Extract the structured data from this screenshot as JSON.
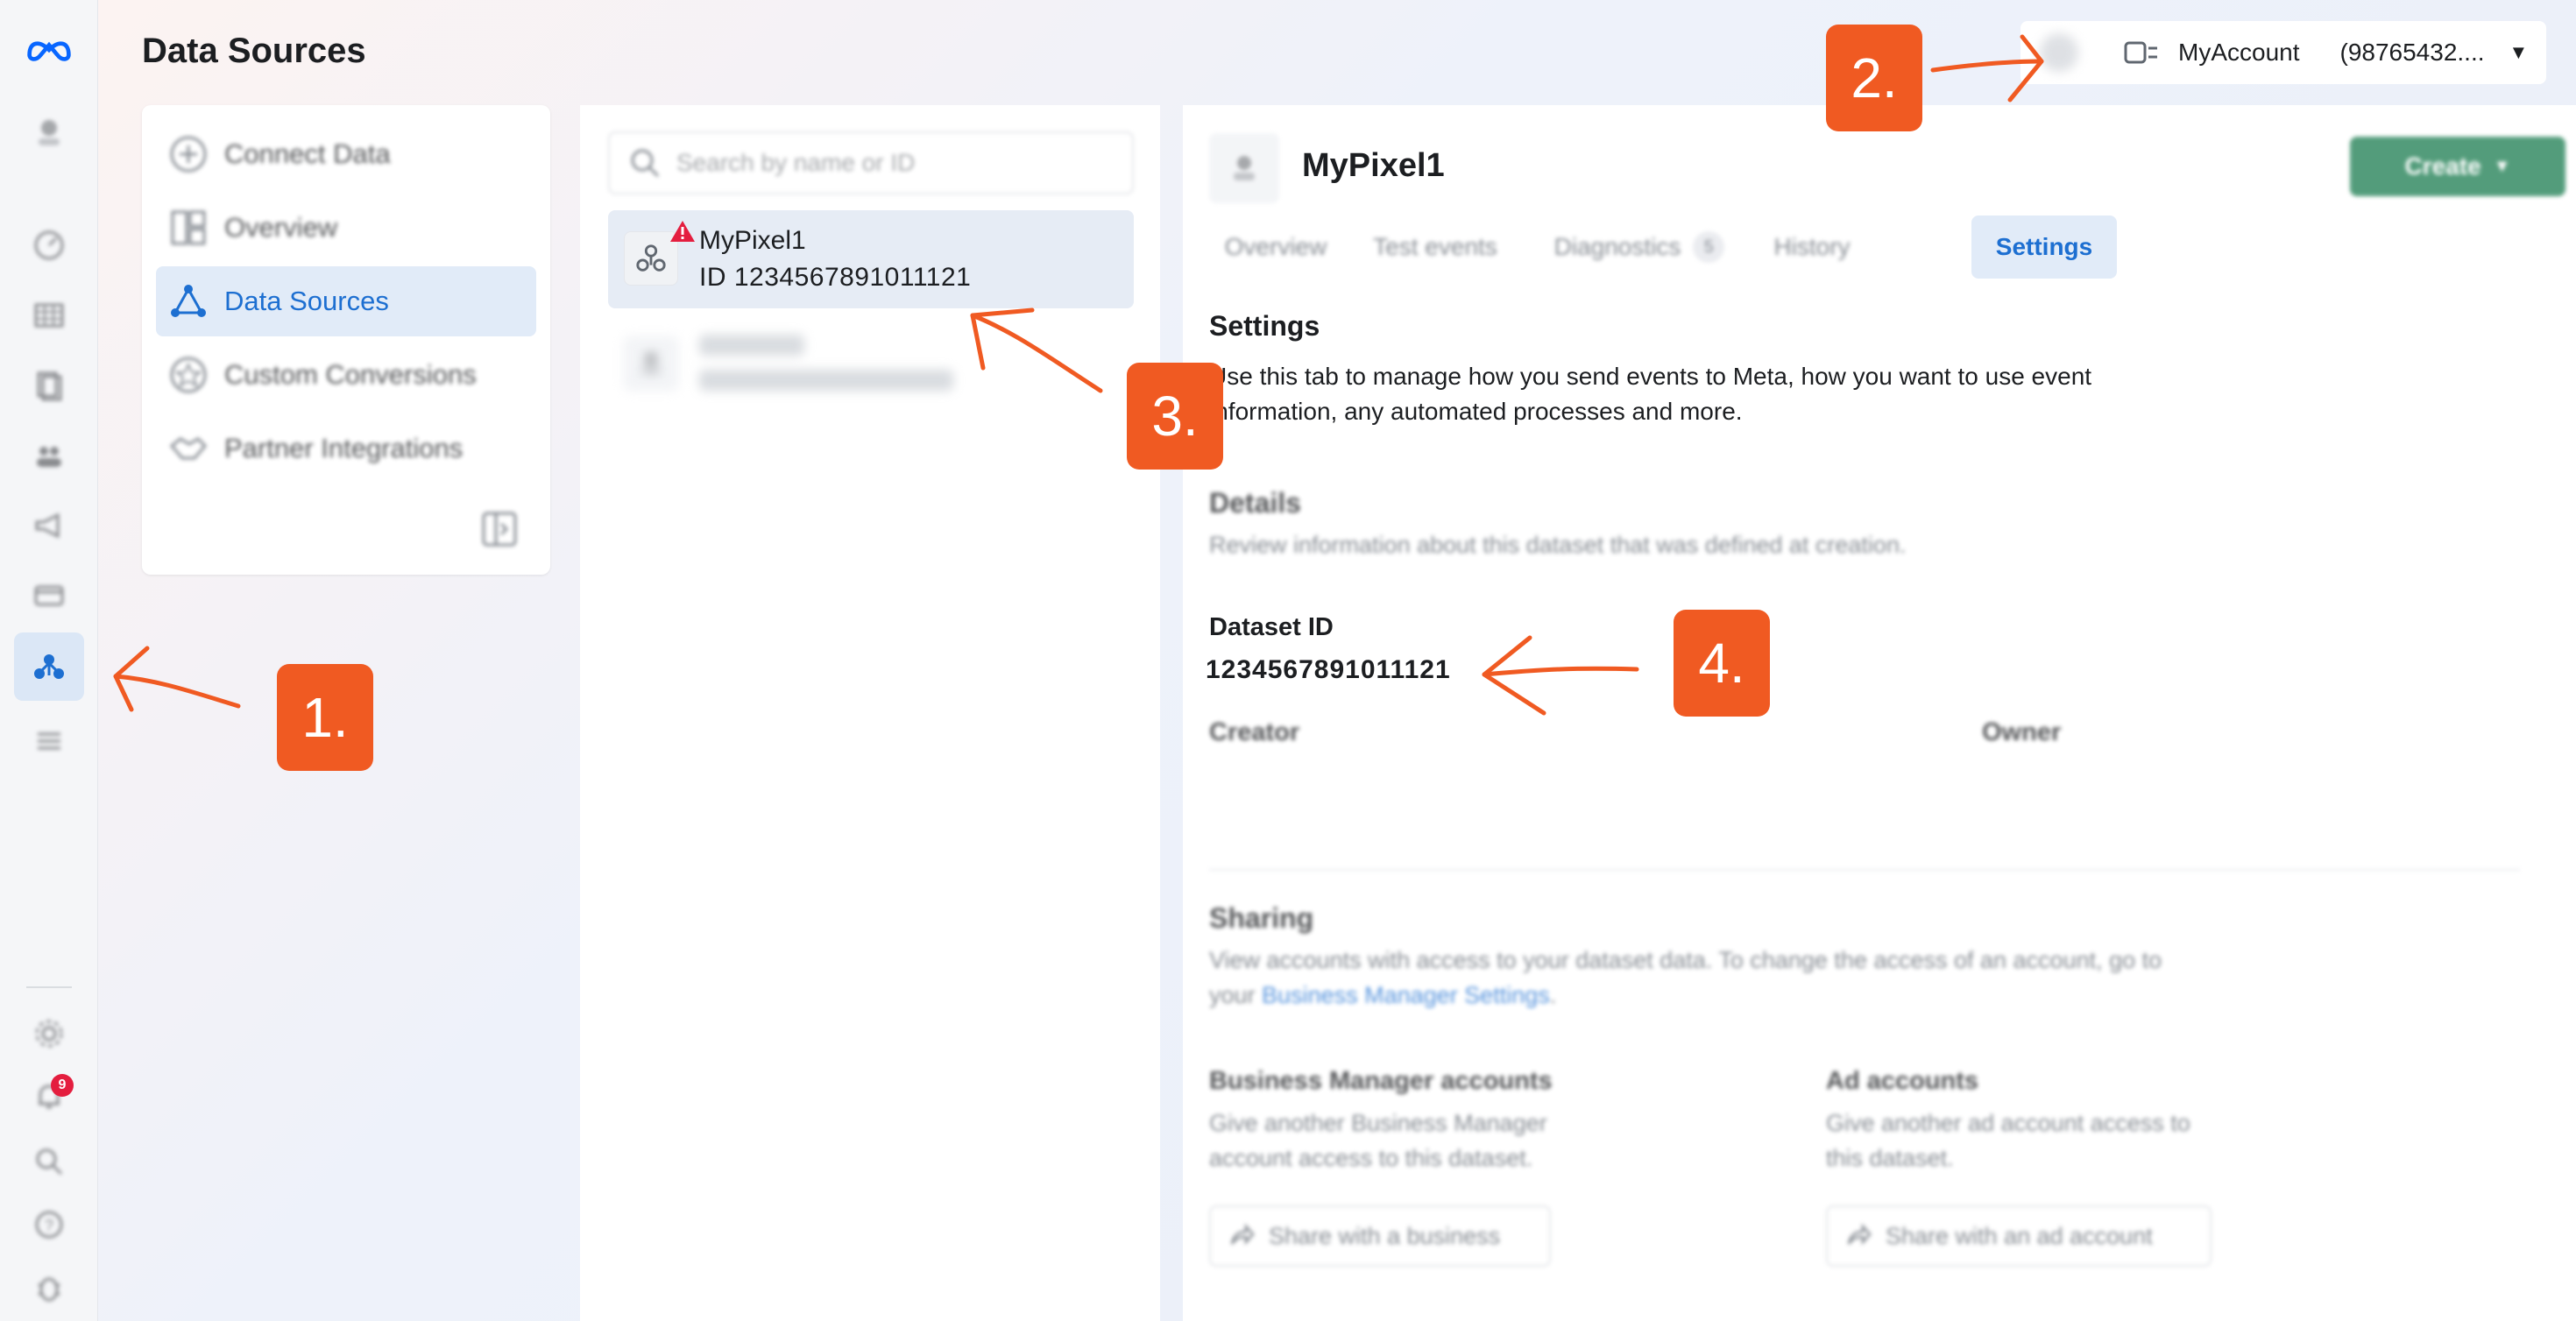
{
  "header": {
    "page_title": "Data Sources",
    "account_name": "MyAccount",
    "account_id": "(98765432...."
  },
  "rail": {
    "notification_count": "9"
  },
  "nav": {
    "items": [
      {
        "label": "Connect Data",
        "icon": "plus-circle-icon"
      },
      {
        "label": "Overview",
        "icon": "layout-icon"
      },
      {
        "label": "Data Sources",
        "icon": "data-sources-icon"
      },
      {
        "label": "Custom Conversions",
        "icon": "badge-icon"
      },
      {
        "label": "Partner Integrations",
        "icon": "handshake-icon"
      }
    ]
  },
  "list": {
    "search_placeholder": "Search by name or ID",
    "items": [
      {
        "name": "MyPixel1",
        "id_text": "ID 1234567891011121",
        "selected": true,
        "warning": true
      }
    ]
  },
  "detail": {
    "title": "MyPixel1",
    "create_label": "Create",
    "tabs": [
      {
        "label": "Overview"
      },
      {
        "label": "Test events"
      },
      {
        "label": "Diagnostics",
        "count": "5"
      },
      {
        "label": "History"
      },
      {
        "label": "Settings",
        "active": true
      }
    ],
    "settings_heading": "Settings",
    "settings_desc_1": "Use this tab to manage how you send events to Meta, how you want to use event",
    "settings_desc_2": "information, any automated processes and more.",
    "details_heading": "Details",
    "details_desc": "Review information about this dataset that was defined at creation.",
    "dataset_id_label": "Dataset ID",
    "dataset_id_value": "1234567891011121",
    "creator_label": "Creator",
    "owner_label": "Owner",
    "sharing_heading": "Sharing",
    "sharing_desc_1": "View accounts with access to your dataset data. To change the access of an account, go to",
    "sharing_desc_2_prefix": "your",
    "sharing_link": "Business Manager Settings",
    "sharing_desc_2_suffix": ".",
    "bm_heading": "Business Manager accounts",
    "bm_desc_1": "Give another Business Manager",
    "bm_desc_2": "account access to this dataset.",
    "bm_button": "Share with a business",
    "ad_heading": "Ad accounts",
    "ad_desc_1": "Give another ad account access to",
    "ad_desc_2": "this dataset.",
    "ad_button": "Share with an ad account"
  },
  "annotations": {
    "steps": [
      "1.",
      "2.",
      "3.",
      "4."
    ],
    "color": "#f05a22"
  },
  "colors": {
    "accent_blue": "#1d6fd1",
    "create_green": "#1a7c4f",
    "warning_red": "#e41e3f"
  }
}
